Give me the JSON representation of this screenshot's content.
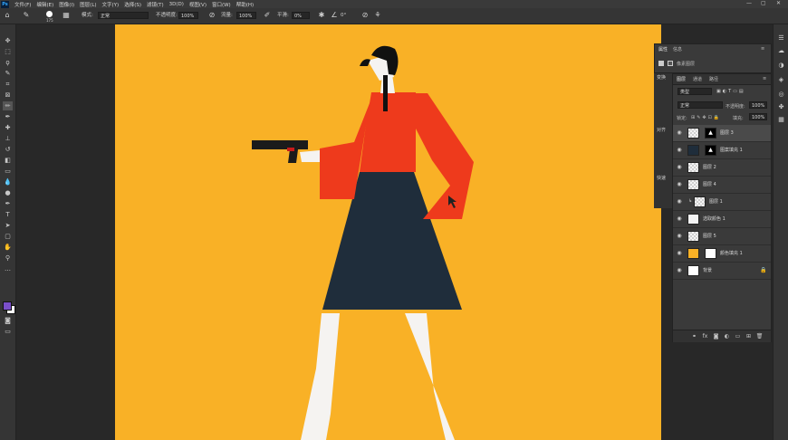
{
  "app": {
    "logo": "Ps"
  },
  "menu": [
    "文件(F)",
    "编辑(E)",
    "图像(I)",
    "图层(L)",
    "文字(Y)",
    "选择(S)",
    "滤镜(T)",
    "3D(D)",
    "视图(V)",
    "窗口(W)",
    "帮助(H)"
  ],
  "options_bar": {
    "brush_size": "175",
    "mode_label": "模式:",
    "mode_value": "正常",
    "opacity_label": "不透明度:",
    "opacity_value": "100%",
    "flow_label": "流量:",
    "flow_value": "100%",
    "smooth_label": "平滑:",
    "smooth_value": "0%",
    "angle_value": "0°"
  },
  "properties_panel": {
    "tabs": [
      "属性",
      "信息"
    ],
    "kind": "像素图层"
  },
  "collapsed_panels": [
    "变换",
    "对齐",
    "快速"
  ],
  "layers_panel": {
    "tabs": [
      "图层",
      "通道",
      "路径"
    ],
    "filter_kind": "类型",
    "blend_mode": "正常",
    "opacity_label": "不透明度:",
    "opacity_value": "100%",
    "lock_label": "锁定:",
    "fill_label": "填充:",
    "fill_value": "100%",
    "layers": [
      {
        "name": "图层 3",
        "thumb": "transparent",
        "mask": "black-shape",
        "selected": true
      },
      {
        "name": "图案填充 1",
        "thumb": "dark",
        "mask": "black-shape",
        "selected": false
      },
      {
        "name": "图层 2",
        "thumb": "transparent",
        "mask": "",
        "selected": false
      },
      {
        "name": "图层 4",
        "thumb": "transparent",
        "mask": "",
        "selected": false
      },
      {
        "name": "图层 1",
        "thumb": "transparent",
        "mask": "",
        "selected": false
      },
      {
        "name": "选取颜色 1",
        "thumb": "figure",
        "mask": "",
        "selected": false
      },
      {
        "name": "图层 5",
        "thumb": "transparent",
        "mask": "",
        "selected": false
      },
      {
        "name": "颜色填充 1",
        "thumb": "orange",
        "mask": "white",
        "selected": false
      },
      {
        "name": "背景",
        "thumb": "white",
        "mask": "",
        "selected": false
      }
    ]
  },
  "colors": {
    "canvas_bg": "#f9b126",
    "dress_top": "#ee3a1c",
    "skirt": "#1f2d3b",
    "foreground": "#7a4fc9",
    "background": "#ffffff"
  }
}
